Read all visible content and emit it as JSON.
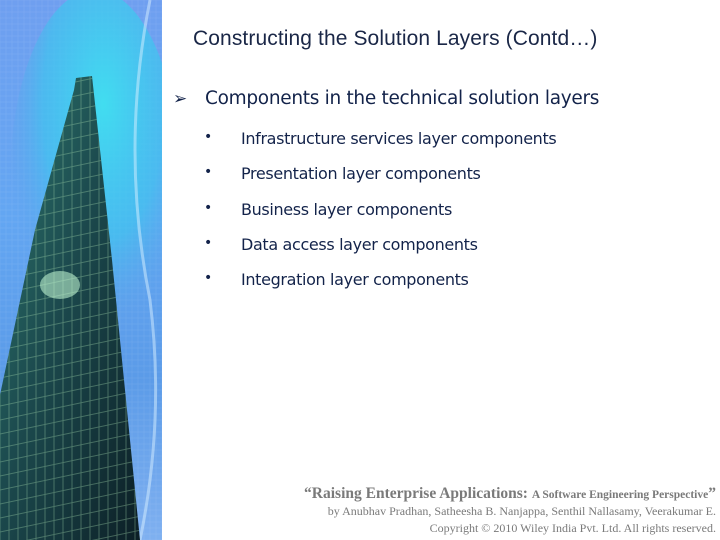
{
  "slide": {
    "title": "Constructing the Solution Layers (Contd…)",
    "main_point": {
      "bullet_icon": "arrow-bullet",
      "bullet_glyph": "➢",
      "text": "Components in the technical solution layers"
    },
    "sub_points": [
      {
        "bullet_glyph": "•",
        "text": "Infrastructure services layer components"
      },
      {
        "bullet_glyph": "•",
        "text": "Presentation layer components"
      },
      {
        "bullet_glyph": "•",
        "text": "Business layer components"
      },
      {
        "bullet_glyph": "•",
        "text": "Data access layer components"
      },
      {
        "bullet_glyph": "•",
        "text": "Integration layer components"
      }
    ],
    "footer": {
      "book_title_main": "“Raising Enterprise Applications: ",
      "book_title_sub": "A Software Engineering Perspective",
      "book_title_close": "”",
      "authors": "by Anubhav Pradhan, Satheesha B. Nanjappa, Senthil Nallasamy, Veerakumar E.",
      "copyright": "Copyright © 2010 Wiley India Pvt. Ltd.  All rights reserved."
    },
    "side_image": {
      "description": "glass-skyscraper-image",
      "colors": {
        "sky": "#5fa6f0",
        "glow": "#3fd8f2",
        "building_dark": "#0f2a30",
        "building_mid": "#2f6f6a"
      }
    }
  }
}
